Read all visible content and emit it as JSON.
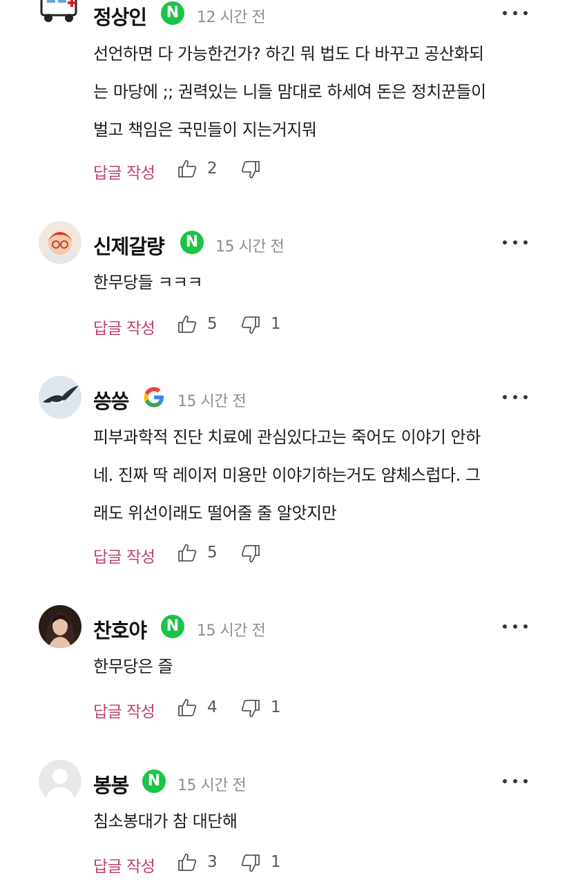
{
  "actions": {
    "reply_label": "답글 작성"
  },
  "comments": [
    {
      "author": "정상인",
      "provider": "naver",
      "time": "12 시간 전",
      "lines": [
        "선언하면 다 가능한건가? 하긴 뭐 법도 다 바꾸고 공산화되",
        "는 마당에 ;; 권력있는 니들 맘대로 하세여 돈은 정치꾼들이",
        "벌고 책임은 국민들이 지는거지뭐"
      ],
      "likes": "2",
      "dislikes": ""
    },
    {
      "author": "신제갈량",
      "provider": "naver",
      "time": "15 시간 전",
      "lines": [
        "한무당들 ㅋㅋㅋ"
      ],
      "likes": "5",
      "dislikes": "1"
    },
    {
      "author": "씅씅",
      "provider": "google",
      "time": "15 시간 전",
      "lines": [
        "피부과학적 진단 치료에 관심있다고는 죽어도 이야기 안하",
        "네. 진짜 딱 레이저 미용만 이야기하는거도 얌체스럽다. 그",
        "래도 위선이래도 떨어줄 줄 알앗지만"
      ],
      "likes": "5",
      "dislikes": ""
    },
    {
      "author": "찬호야",
      "provider": "naver",
      "time": "15 시간 전",
      "lines": [
        "한무당은 즐"
      ],
      "likes": "4",
      "dislikes": "1"
    },
    {
      "author": "봉봉",
      "provider": "naver",
      "time": "15 시간 전",
      "lines": [
        "침소봉대가 참 대단해"
      ],
      "likes": "3",
      "dislikes": "1"
    }
  ],
  "badge_text": {
    "naver": "N"
  },
  "colors": {
    "reply": "#c0416a",
    "naver": "#19c447",
    "time": "#8e8e8e"
  }
}
